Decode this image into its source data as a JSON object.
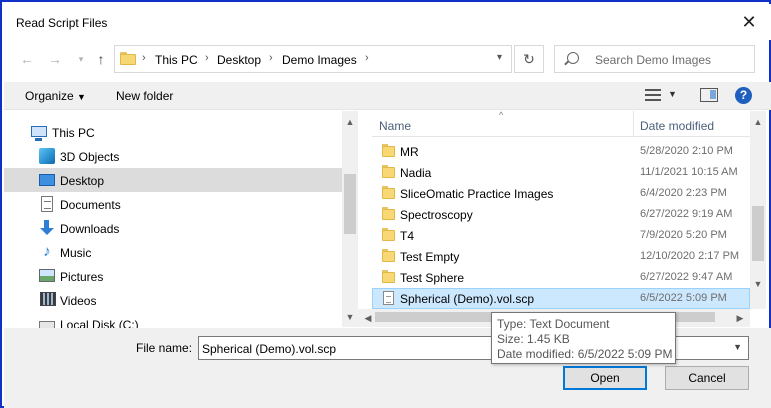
{
  "window": {
    "title": "Read Script Files",
    "close_label": "✕"
  },
  "address_bar": {
    "breadcrumbs": [
      "This PC",
      "Desktop",
      "Demo Images"
    ],
    "search_placeholder": "Search Demo Images"
  },
  "command_bar": {
    "organize_label": "Organize",
    "new_folder_label": "New folder",
    "help_label": "?"
  },
  "nav_pane": {
    "items": [
      {
        "label": "This PC",
        "icon": "computer-icon"
      },
      {
        "label": "3D Objects",
        "icon": "cube-icon"
      },
      {
        "label": "Desktop",
        "icon": "desktop-icon",
        "selected": true
      },
      {
        "label": "Documents",
        "icon": "document-icon"
      },
      {
        "label": "Downloads",
        "icon": "download-arrow-icon"
      },
      {
        "label": "Music",
        "icon": "music-note-icon"
      },
      {
        "label": "Pictures",
        "icon": "picture-icon"
      },
      {
        "label": "Videos",
        "icon": "film-icon"
      },
      {
        "label": "Local Disk (C:)",
        "icon": "disk-drive-icon"
      }
    ]
  },
  "file_list": {
    "columns": [
      "Name",
      "Date modified"
    ],
    "rows": [
      {
        "name": "MR",
        "date": "5/28/2020 2:10 PM",
        "type": "folder"
      },
      {
        "name": "Nadia",
        "date": "11/1/2021 10:15 AM",
        "type": "folder"
      },
      {
        "name": "SliceOmatic Practice Images",
        "date": "6/4/2020 2:23 PM",
        "type": "folder"
      },
      {
        "name": "Spectroscopy",
        "date": "6/27/2022 9:19 AM",
        "type": "folder"
      },
      {
        "name": "T4",
        "date": "7/9/2020 5:20 PM",
        "type": "folder"
      },
      {
        "name": "Test Empty",
        "date": "12/10/2020 2:17 PM",
        "type": "folder"
      },
      {
        "name": "Test Sphere",
        "date": "6/27/2022 9:47 AM",
        "type": "folder"
      },
      {
        "name": "Spherical (Demo).vol.scp",
        "date": "6/5/2022 5:09 PM",
        "type": "file",
        "selected": true
      }
    ]
  },
  "tooltip": {
    "type_line": "Type: Text Document",
    "size_line": "Size: 1.45 KB",
    "date_line": "Date modified: 6/5/2022 5:09 PM"
  },
  "footer": {
    "file_name_label": "File name:",
    "file_name_value": "Spherical (Demo).vol.scp",
    "open_label": "Open",
    "cancel_label": "Cancel"
  },
  "colors": {
    "frame_border": "#1030c8",
    "selection_bg": "#cce8ff",
    "selection_border": "#99d1ff",
    "folder_yellow": "#f8d775",
    "primary_button_border": "#0078d7"
  }
}
